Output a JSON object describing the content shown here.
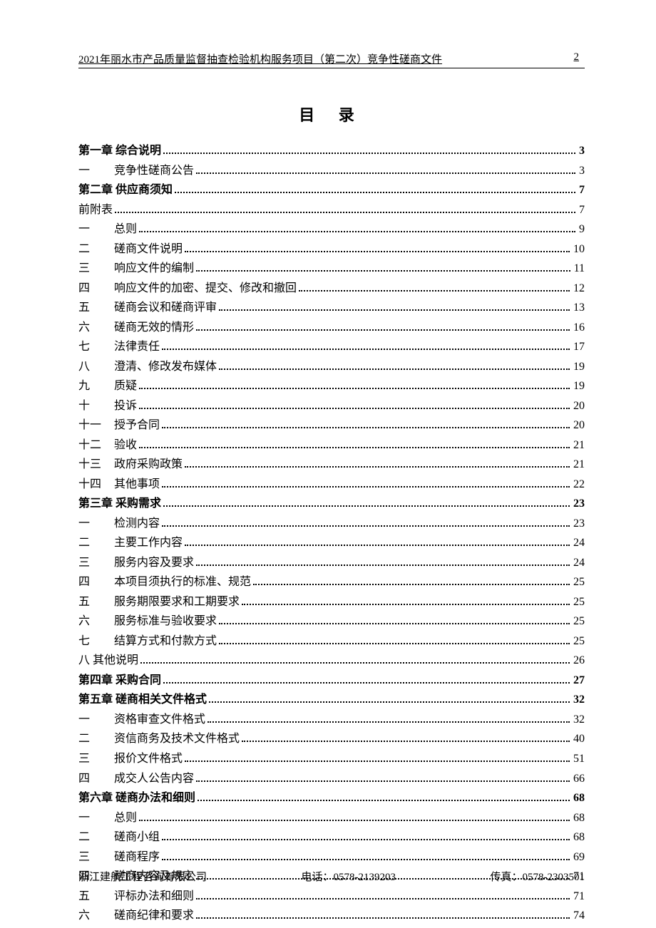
{
  "header": {
    "title": "2021年丽水市产品质量监督抽查检验机构服务项目（第二次）竞争性磋商文件",
    "page_number": "2"
  },
  "toc_heading": "目  录",
  "toc": [
    {
      "type": "chapter",
      "label": "第一章",
      "title": "综合说明",
      "page": "3"
    },
    {
      "type": "sub",
      "label": "一",
      "title": "竞争性磋商公告",
      "page": "3"
    },
    {
      "type": "chapter",
      "label": "第二章",
      "title": "供应商须知",
      "page": "7"
    },
    {
      "type": "plain",
      "label": "",
      "title": "前附表",
      "page": "7"
    },
    {
      "type": "sub",
      "label": "一",
      "title": "总则",
      "page": "9"
    },
    {
      "type": "sub",
      "label": "二",
      "title": "磋商文件说明",
      "page": "10"
    },
    {
      "type": "sub",
      "label": "三",
      "title": "响应文件的编制",
      "page": "11"
    },
    {
      "type": "sub",
      "label": "四",
      "title": "响应文件的加密、提交、修改和撤回",
      "page": "12"
    },
    {
      "type": "sub",
      "label": "五",
      "title": "磋商会议和磋商评审",
      "page": "13"
    },
    {
      "type": "sub",
      "label": "六",
      "title": "磋商无效的情形",
      "page": "16"
    },
    {
      "type": "sub",
      "label": "七",
      "title": "法律责任",
      "page": "17"
    },
    {
      "type": "sub",
      "label": "八",
      "title": "澄清、修改发布媒体",
      "page": "19"
    },
    {
      "type": "sub",
      "label": "九",
      "title": "质疑",
      "page": "19"
    },
    {
      "type": "sub",
      "label": "十",
      "title": "投诉",
      "page": "20"
    },
    {
      "type": "sub",
      "label": "十一",
      "title": "授予合同",
      "page": "20"
    },
    {
      "type": "sub",
      "label": "十二",
      "title": "验收",
      "page": "21"
    },
    {
      "type": "sub",
      "label": "十三",
      "title": "政府采购政策",
      "page": "21"
    },
    {
      "type": "sub",
      "label": "十四",
      "title": "其他事项",
      "page": "22"
    },
    {
      "type": "chapter",
      "label": "第三章",
      "title": "采购需求",
      "page": "23"
    },
    {
      "type": "sub",
      "label": "一",
      "title": "检测内容",
      "page": "23"
    },
    {
      "type": "sub",
      "label": "二",
      "title": "主要工作内容",
      "page": "24"
    },
    {
      "type": "sub",
      "label": "三",
      "title": "服务内容及要求",
      "page": "24"
    },
    {
      "type": "sub",
      "label": "四",
      "title": "本项目须执行的标准、规范",
      "page": "25"
    },
    {
      "type": "sub",
      "label": "五",
      "title": "服务期限要求和工期要求",
      "page": "25"
    },
    {
      "type": "sub",
      "label": "六",
      "title": "服务标准与验收要求",
      "page": "25"
    },
    {
      "type": "sub",
      "label": "七",
      "title": "结算方式和付款方式",
      "page": "25"
    },
    {
      "type": "sub-tight",
      "label": "八",
      "title": "其他说明",
      "page": "26"
    },
    {
      "type": "chapter",
      "label": "第四章",
      "title": "采购合同",
      "page": "27"
    },
    {
      "type": "chapter",
      "label": "第五章",
      "title": "磋商相关文件格式",
      "page": "32"
    },
    {
      "type": "sub",
      "label": "一",
      "title": "资格审查文件格式",
      "page": "32"
    },
    {
      "type": "sub",
      "label": "二",
      "title": "资信商务及技术文件格式",
      "page": "40"
    },
    {
      "type": "sub",
      "label": "三",
      "title": "报价文件格式",
      "page": "51"
    },
    {
      "type": "sub",
      "label": "四",
      "title": "成交人公告内容",
      "page": "66"
    },
    {
      "type": "chapter",
      "label": "第六章",
      "title": "磋商办法和细则",
      "page": "68"
    },
    {
      "type": "sub",
      "label": "一",
      "title": "总则",
      "page": "68"
    },
    {
      "type": "sub",
      "label": "二",
      "title": "磋商小组",
      "page": "68"
    },
    {
      "type": "sub",
      "label": "三",
      "title": "磋商程序",
      "page": "69"
    },
    {
      "type": "sub",
      "label": "四",
      "title": "磋商内容及规定",
      "page": "71"
    },
    {
      "type": "sub",
      "label": "五",
      "title": "评标办法和细则",
      "page": "71"
    },
    {
      "type": "sub",
      "label": "六",
      "title": "磋商纪律和要求",
      "page": "74"
    }
  ],
  "footer": {
    "company": "浙江建航工程咨询有限公司",
    "phone_label": "电话：",
    "phone": "0578-2139203",
    "fax_label": "传真：",
    "fax": "0578-2303501"
  }
}
